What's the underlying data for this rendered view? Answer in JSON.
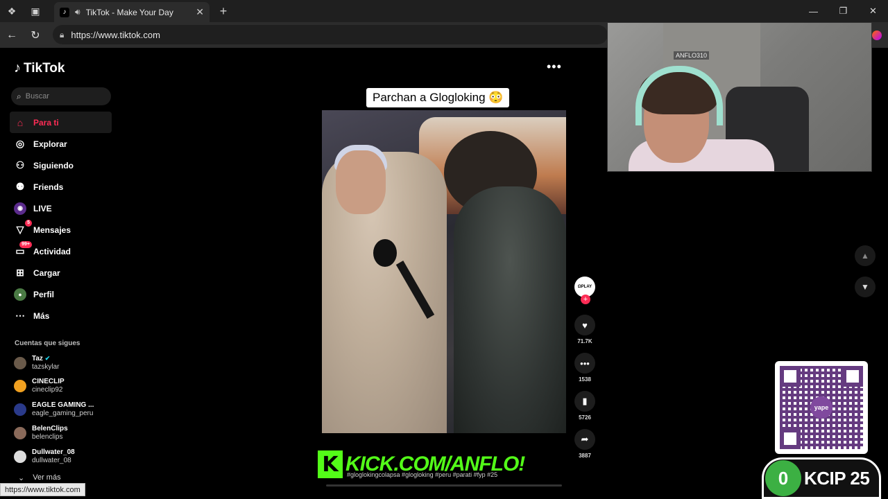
{
  "browser": {
    "tab_title": "TikTok - Make Your Day",
    "url": "https://www.tiktok.com",
    "status_url": "https://www.tiktok.com"
  },
  "tiktok": {
    "logo": "TikTok",
    "search_placeholder": "Buscar",
    "menu": [
      {
        "label": "Para ti",
        "icon": "home-icon",
        "active": true
      },
      {
        "label": "Explorar",
        "icon": "compass-icon"
      },
      {
        "label": "Siguiendo",
        "icon": "following-icon"
      },
      {
        "label": "Friends",
        "icon": "friends-icon"
      },
      {
        "label": "LIVE",
        "icon": "live-icon"
      },
      {
        "label": "Mensajes",
        "icon": "messages-icon",
        "badge": "5"
      },
      {
        "label": "Actividad",
        "icon": "activity-icon",
        "badge": "99+"
      },
      {
        "label": "Cargar",
        "icon": "upload-icon"
      },
      {
        "label": "Perfil",
        "icon": "profile-icon"
      },
      {
        "label": "Más",
        "icon": "more-icon"
      }
    ],
    "following_title": "Cuentas que sigues",
    "accounts": [
      {
        "name": "Taz",
        "handle": "tazskylar",
        "verified": true
      },
      {
        "name": "CINECLIP",
        "handle": "cineclip92"
      },
      {
        "name": "EAGLE GAMING ...",
        "handle": "eagle_gaming_peru"
      },
      {
        "name": "BelenClips",
        "handle": "belenclips"
      },
      {
        "name": "Dullwater_08",
        "handle": "dullwater_08"
      }
    ],
    "see_more": "Ver más",
    "video": {
      "caption": "Parchan a Glogloking 😳",
      "likes": "71.7K",
      "comments": "1538",
      "saves": "5726",
      "shares": "3887",
      "hashtags": "#gloglokingcolapsa #glogloking #peru #parati #fyp #25"
    }
  },
  "overlay": {
    "kick_url": "KICK.COM/ANFLO!",
    "kick_letter": "K",
    "webcam_sign": "ANFLO310",
    "qr_label": "yape",
    "kcip_count": "0",
    "kcip_label": "KCIP 25"
  }
}
